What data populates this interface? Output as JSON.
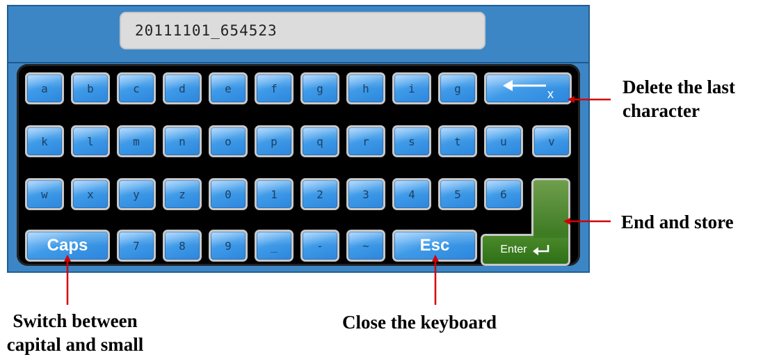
{
  "input": {
    "value": "20111101_654523"
  },
  "keys": {
    "row1": [
      "a",
      "b",
      "c",
      "d",
      "e",
      "f",
      "g",
      "h",
      "i",
      "g"
    ],
    "row2": [
      "k",
      "l",
      "m",
      "n",
      "o",
      "p",
      "q",
      "r",
      "s",
      "t",
      "u",
      "v"
    ],
    "row3": [
      "w",
      "x",
      "y",
      "z",
      "0",
      "1",
      "2",
      "3",
      "4",
      "5",
      "6"
    ],
    "caps": "Caps",
    "row4": [
      "7",
      "8",
      "9",
      "_",
      "-",
      "~"
    ],
    "esc": "Esc",
    "backspace_mark": "x",
    "enter": "Enter"
  },
  "annotations": {
    "delete_line1": "Delete the last",
    "delete_line2": "character",
    "end_store": "End and store",
    "switch_line1": "Switch between",
    "switch_line2": "capital and small",
    "close_keyboard": "Close the keyboard"
  },
  "colors": {
    "panel": "#3d86c6",
    "key_blue": "#3f9be8",
    "enter_green": "#3c7a22",
    "arrow_red": "#d40000"
  },
  "icons": {
    "backspace": "backspace-arrow-icon",
    "enter": "enter-return-icon"
  }
}
